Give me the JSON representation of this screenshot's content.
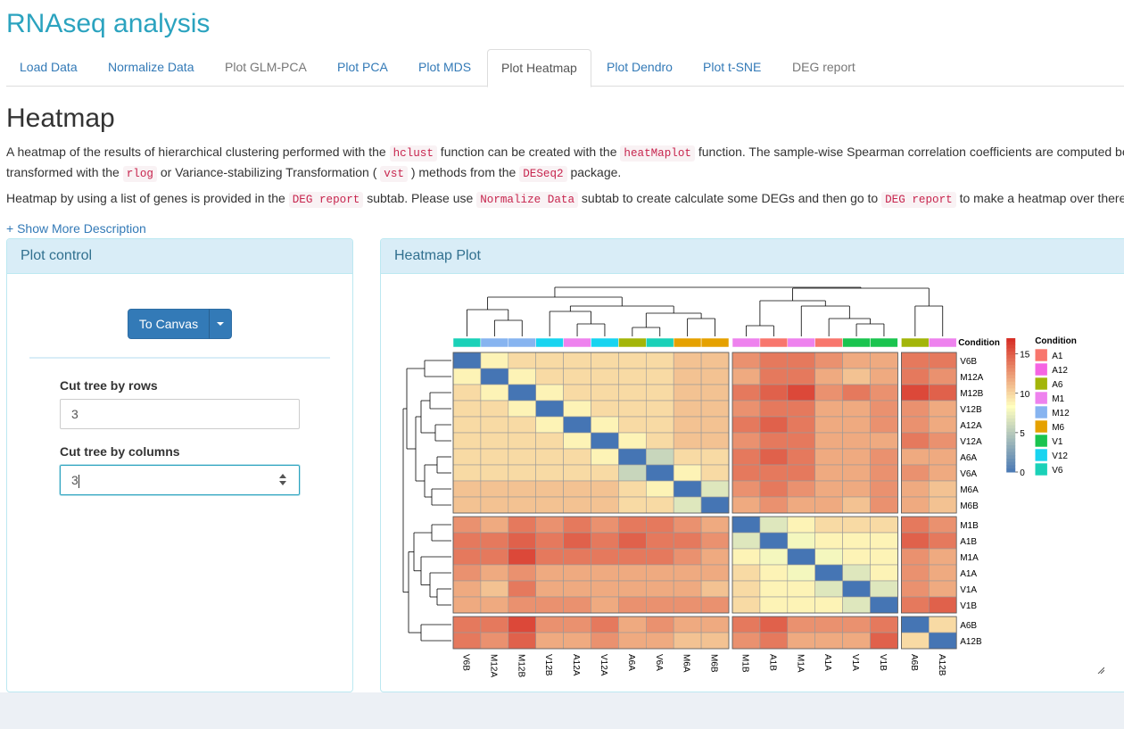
{
  "app_title": "RNAseq analysis",
  "tabs": [
    {
      "label": "Load Data",
      "state": "link"
    },
    {
      "label": "Normalize Data",
      "state": "link"
    },
    {
      "label": "Plot GLM-PCA",
      "state": "gray"
    },
    {
      "label": "Plot PCA",
      "state": "link"
    },
    {
      "label": "Plot MDS",
      "state": "link"
    },
    {
      "label": "Plot Heatmap",
      "state": "active"
    },
    {
      "label": "Plot Dendro",
      "state": "link"
    },
    {
      "label": "Plot t-SNE",
      "state": "link"
    },
    {
      "label": "DEG report",
      "state": "gray"
    }
  ],
  "page_heading": "Heatmap",
  "desc1": {
    "t1": "A heatmap of the results of hierarchical clustering performed with the ",
    "c1": "hclust",
    "t2": " function can be created with the ",
    "c2": "heatMaplot",
    "t3": " function. The sample-wise Spearman correlation coefficients are computed be",
    "t4": "transformed with the ",
    "c3": "rlog",
    "t5": " or Variance-stabilizing Transformation ( ",
    "c4": "vst",
    "t6": " ) methods from the ",
    "c5": "DESeq2",
    "t7": " package."
  },
  "desc2": {
    "t1": "Heatmap by using a list of genes is provided in the ",
    "c1": "DEG report",
    "t2": " subtab. Please use ",
    "c2": "Normalize Data",
    "t3": " subtab to create calculate some DEGs and then go to ",
    "c3": "DEG report",
    "t4": " to make a heatmap over there"
  },
  "show_more": "+ Show More Description",
  "plot_control": {
    "title": "Plot control",
    "to_canvas": "To Canvas",
    "cut_rows_label": "Cut tree by rows",
    "cut_rows_value": "3",
    "cut_cols_label": "Cut tree by columns",
    "cut_cols_value": "3"
  },
  "heatmap_panel": {
    "title": "Heatmap Plot"
  },
  "chart_data": {
    "type": "heatmap",
    "title": "",
    "columns": [
      "V6B",
      "M12A",
      "M12B",
      "V12B",
      "A12A",
      "V12A",
      "A6A",
      "V6A",
      "M6A",
      "M6B",
      "M1B",
      "A1B",
      "M1A",
      "A1A",
      "V1A",
      "V1B",
      "A6B",
      "A12B"
    ],
    "rows": [
      "V6B",
      "M12A",
      "M12B",
      "V12B",
      "A12A",
      "V12A",
      "A6A",
      "V6A",
      "M6A",
      "M6B",
      "M1B",
      "A1B",
      "M1A",
      "A1A",
      "V1A",
      "V1B",
      "A6B",
      "A12B"
    ],
    "row_splits": [
      10,
      6,
      2
    ],
    "col_splits": [
      10,
      6,
      2
    ],
    "annotation_title": "Condition",
    "column_conditions": [
      "V6",
      "M12",
      "M12",
      "V12",
      "M1",
      "V12",
      "A6",
      "V6",
      "M6",
      "M6",
      "M1",
      "A1",
      "M1",
      "A1",
      "V1",
      "V1",
      "A6",
      "M1"
    ],
    "scale": {
      "min": 0,
      "max": 17,
      "ticks": [
        0,
        5,
        10,
        15
      ],
      "colors": [
        "#4575b4",
        "#ffffbf",
        "#d73027"
      ]
    },
    "legend": {
      "title": "Condition",
      "entries": [
        {
          "label": "A1",
          "color": "#f8766d"
        },
        {
          "label": "A12",
          "color": "#f564e3"
        },
        {
          "label": "A6",
          "color": "#a3b509"
        },
        {
          "label": "M1",
          "color": "#ee82ee"
        },
        {
          "label": "M12",
          "color": "#87b4f0"
        },
        {
          "label": "M6",
          "color": "#e5a100"
        },
        {
          "label": "V1",
          "color": "#1ac44f"
        },
        {
          "label": "V12",
          "color": "#18d4f0"
        },
        {
          "label": "V6",
          "color": "#1ad1b8"
        }
      ]
    },
    "values": [
      [
        0,
        9,
        10,
        10,
        10,
        10,
        10,
        10,
        11,
        11,
        13,
        14,
        14,
        13,
        12,
        12,
        14,
        14
      ],
      [
        9,
        0,
        9,
        10,
        10,
        10,
        10,
        10,
        11,
        11,
        12,
        14,
        14,
        12,
        11,
        12,
        14,
        13
      ],
      [
        10,
        9,
        0,
        9,
        10,
        10,
        10,
        10,
        11,
        11,
        14,
        15,
        16,
        13,
        14,
        13,
        16,
        15
      ],
      [
        10,
        10,
        9,
        0,
        9,
        10,
        10,
        10,
        11,
        11,
        13,
        14,
        14,
        12,
        12,
        13,
        13,
        12
      ],
      [
        10,
        10,
        10,
        9,
        0,
        9,
        10,
        10,
        11,
        11,
        14,
        15,
        14,
        12,
        12,
        13,
        13,
        12
      ],
      [
        10,
        10,
        10,
        10,
        9,
        0,
        9,
        10,
        11,
        11,
        13,
        14,
        14,
        12,
        12,
        12,
        14,
        13
      ],
      [
        10,
        10,
        10,
        10,
        10,
        9,
        0,
        6,
        10,
        10,
        14,
        15,
        14,
        12,
        12,
        13,
        12,
        12
      ],
      [
        10,
        10,
        10,
        10,
        10,
        10,
        6,
        0,
        9,
        10,
        14,
        14,
        14,
        12,
        12,
        13,
        13,
        12
      ],
      [
        11,
        11,
        11,
        11,
        11,
        11,
        10,
        9,
        0,
        7,
        13,
        14,
        13,
        12,
        12,
        13,
        12,
        11
      ],
      [
        11,
        11,
        11,
        11,
        11,
        11,
        10,
        10,
        7,
        0,
        12,
        13,
        12,
        12,
        11,
        13,
        12,
        11
      ],
      [
        13,
        12,
        14,
        13,
        14,
        13,
        14,
        14,
        13,
        12,
        0,
        7,
        9,
        10,
        10,
        10,
        14,
        13
      ],
      [
        14,
        14,
        15,
        14,
        15,
        14,
        15,
        14,
        14,
        13,
        7,
        0,
        8,
        9,
        9,
        9,
        15,
        14
      ],
      [
        14,
        14,
        16,
        14,
        14,
        14,
        14,
        14,
        13,
        12,
        9,
        8,
        0,
        8,
        9,
        9,
        13,
        12
      ],
      [
        13,
        12,
        13,
        12,
        12,
        12,
        12,
        12,
        12,
        12,
        10,
        9,
        8,
        0,
        7,
        9,
        13,
        12
      ],
      [
        12,
        11,
        14,
        12,
        12,
        12,
        12,
        12,
        12,
        11,
        10,
        9,
        9,
        7,
        0,
        7,
        13,
        12
      ],
      [
        12,
        12,
        13,
        13,
        13,
        12,
        13,
        13,
        13,
        13,
        10,
        9,
        9,
        9,
        7,
        0,
        14,
        15
      ],
      [
        14,
        14,
        16,
        13,
        13,
        14,
        12,
        13,
        12,
        12,
        14,
        15,
        13,
        13,
        13,
        14,
        0,
        10
      ],
      [
        14,
        13,
        15,
        12,
        12,
        13,
        12,
        12,
        11,
        11,
        13,
        14,
        12,
        12,
        12,
        15,
        10,
        0
      ]
    ]
  }
}
